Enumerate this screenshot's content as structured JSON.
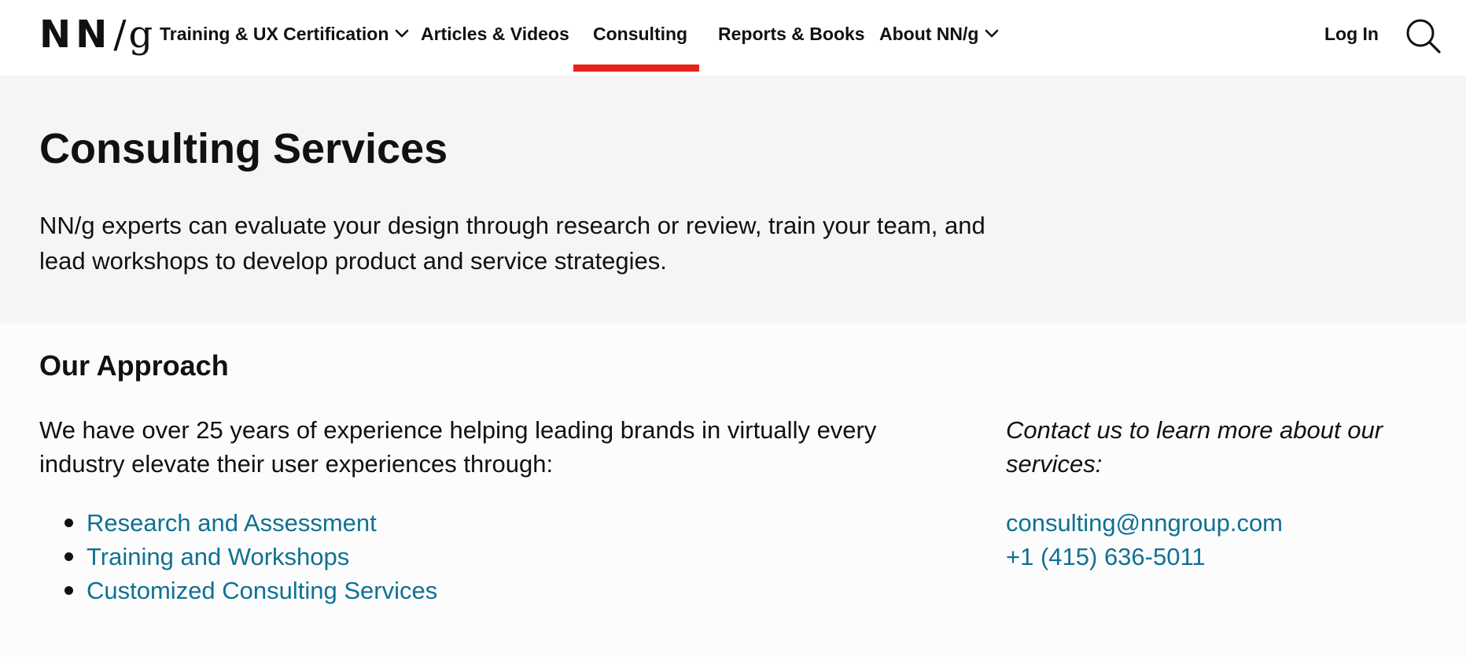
{
  "header": {
    "logo": {
      "nn": "NN",
      "slash": "/",
      "g": "g"
    },
    "nav": [
      {
        "label": "Training & UX Certification",
        "has_dropdown": true,
        "active": false
      },
      {
        "label": "Articles & Videos",
        "has_dropdown": false,
        "active": false
      },
      {
        "label": "Consulting",
        "has_dropdown": false,
        "active": true
      },
      {
        "label": "Reports & Books",
        "has_dropdown": false,
        "active": false
      },
      {
        "label": "About NN/g",
        "has_dropdown": true,
        "active": false
      }
    ],
    "login_label": "Log In",
    "search_icon": "search-icon"
  },
  "hero": {
    "title": "Consulting Services",
    "description": "NN/g experts can evaluate your design through research or review, train your team, and lead workshops to develop product and service strategies."
  },
  "approach": {
    "heading": "Our Approach",
    "intro": "We have over 25 years of experience helping leading brands in virtually every industry elevate their user experiences through:",
    "services": [
      "Research and Assessment",
      "Training and Workshops",
      "Customized Consulting Services"
    ]
  },
  "contact": {
    "prompt": "Contact us to learn more about our services:",
    "email": "consulting@nngroup.com",
    "phone": "+1 (415) 636-5011"
  },
  "colors": {
    "accent_bar": "#e8221b",
    "link": "#0f7193",
    "hero_bg": "#f5f4f6",
    "text": "#111111"
  }
}
